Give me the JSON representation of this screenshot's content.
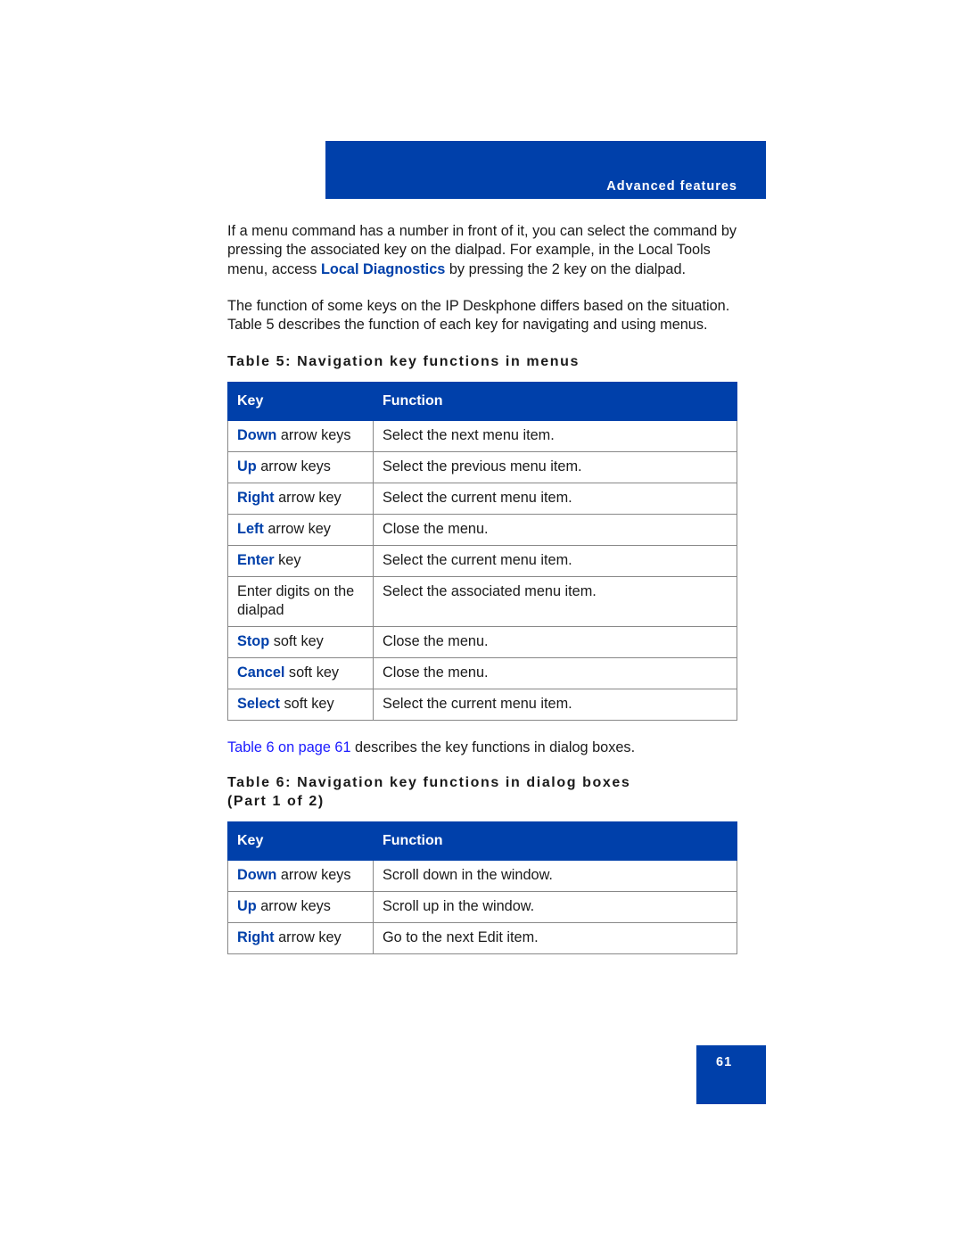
{
  "header": {
    "section_title": "Advanced features"
  },
  "intro": {
    "p1_before": "If a menu command has a number in front of it, you can select the command by pressing the associated key on the dialpad. For example, in the Local Tools menu, access ",
    "p1_highlight": "Local Diagnostics",
    "p1_after": " by pressing the 2 key on the dialpad.",
    "p2": "The function of some keys on the IP Deskphone differs based on the situation. Table 5 describes the function of each key for navigating and using menus."
  },
  "table5": {
    "caption": "Table 5: Navigation key functions in menus",
    "headers": {
      "key": "Key",
      "function": "Function"
    },
    "rows": [
      {
        "key_bold": "Down",
        "key_rest": " arrow keys",
        "function": "Select the next menu item."
      },
      {
        "key_bold": "Up",
        "key_rest": " arrow keys",
        "function": "Select the previous menu item."
      },
      {
        "key_bold": "Right",
        "key_rest": " arrow key",
        "function": "Select the current menu item."
      },
      {
        "key_bold": "Left",
        "key_rest": " arrow key",
        "function": "Close the menu."
      },
      {
        "key_bold": "Enter",
        "key_rest": " key",
        "function": "Select the current menu item."
      },
      {
        "key_bold": "",
        "key_rest": "Enter digits on the dialpad",
        "function": "Select the associated menu item."
      },
      {
        "key_bold": "Stop",
        "key_rest": " soft key",
        "function": "Close the menu."
      },
      {
        "key_bold": "Cancel",
        "key_rest": " soft key",
        "function": "Close the menu."
      },
      {
        "key_bold": "Select",
        "key_rest": " soft key",
        "function": "Select the current menu item."
      }
    ]
  },
  "between": {
    "link": "Table 6 on page 61",
    "rest": " describes the key functions in dialog boxes."
  },
  "table6": {
    "caption_line1": "Table 6: Navigation key functions in dialog boxes",
    "caption_line2": "(Part 1 of 2)",
    "headers": {
      "key": "Key",
      "function": "Function"
    },
    "rows": [
      {
        "key_bold": "Down",
        "key_rest": " arrow keys",
        "function": "Scroll down in the window."
      },
      {
        "key_bold": "Up",
        "key_rest": " arrow keys",
        "function": "Scroll up in the window."
      },
      {
        "key_bold": "Right",
        "key_rest": " arrow key",
        "function": "Go to the next Edit item."
      }
    ]
  },
  "footer": {
    "page_number": "61"
  },
  "colors": {
    "brand_blue": "#0040AA",
    "link_blue": "#1a1aff"
  }
}
